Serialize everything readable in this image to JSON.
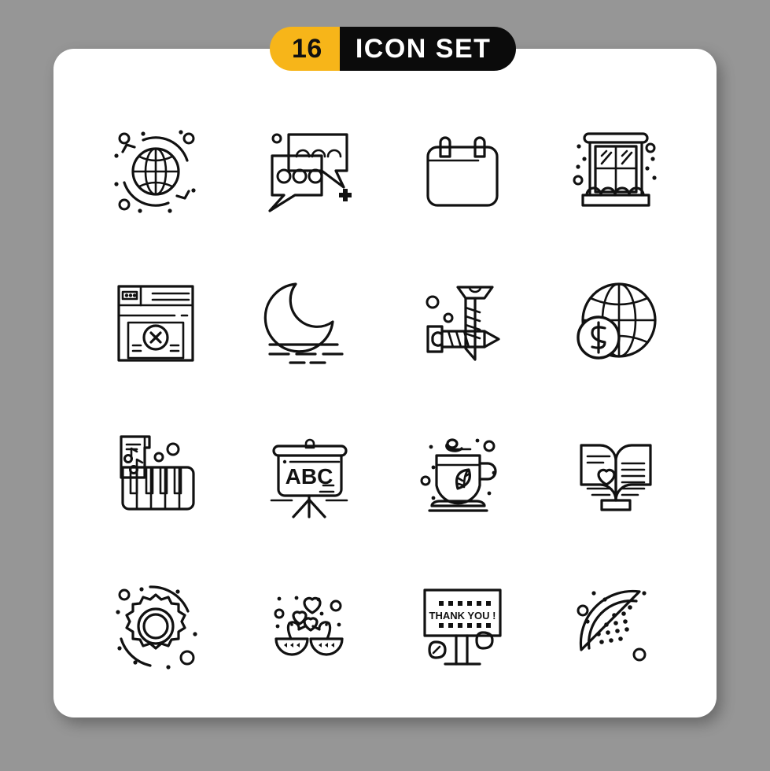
{
  "header": {
    "count": "16",
    "title": "ICON SET",
    "badge_count_bg": "#F7B519",
    "badge_title_bg": "#0B0B0B",
    "badge_title_color": "#FFFFFF"
  },
  "page": {
    "background_color": "#969696",
    "card_color": "#FFFFFF",
    "icon_stroke_color": "#111111"
  },
  "icons": [
    {
      "name": "globe-refresh-icon",
      "label": "Global Refresh"
    },
    {
      "name": "chat-bubbles-icon",
      "label": "Chat Messages"
    },
    {
      "name": "calendar-icon",
      "label": "Calendar"
    },
    {
      "name": "snow-window-icon",
      "label": "Winter Window"
    },
    {
      "name": "browser-error-icon",
      "label": "Browser Error"
    },
    {
      "name": "crescent-moon-fog-icon",
      "label": "Night Fog"
    },
    {
      "name": "crossed-screws-icon",
      "label": "Screws"
    },
    {
      "name": "globe-dollar-icon",
      "label": "Global Currency"
    },
    {
      "name": "piano-sheet-music-icon",
      "label": "Piano Music"
    },
    {
      "name": "abc-presentation-icon",
      "label": "ABC Board"
    },
    {
      "name": "tea-cup-leaf-icon",
      "label": "Green Tea"
    },
    {
      "name": "open-book-heart-icon",
      "label": "Love Book"
    },
    {
      "name": "gear-settings-icon",
      "label": "Settings Gear"
    },
    {
      "name": "love-birds-icon",
      "label": "Love Birds"
    },
    {
      "name": "thank-you-billboard-icon",
      "label": "Thank You Billboard"
    },
    {
      "name": "watermelon-slice-icon",
      "label": "Watermelon"
    }
  ],
  "icon_text": {
    "abc_board": "ABC",
    "billboard": "THANK YOU !"
  }
}
